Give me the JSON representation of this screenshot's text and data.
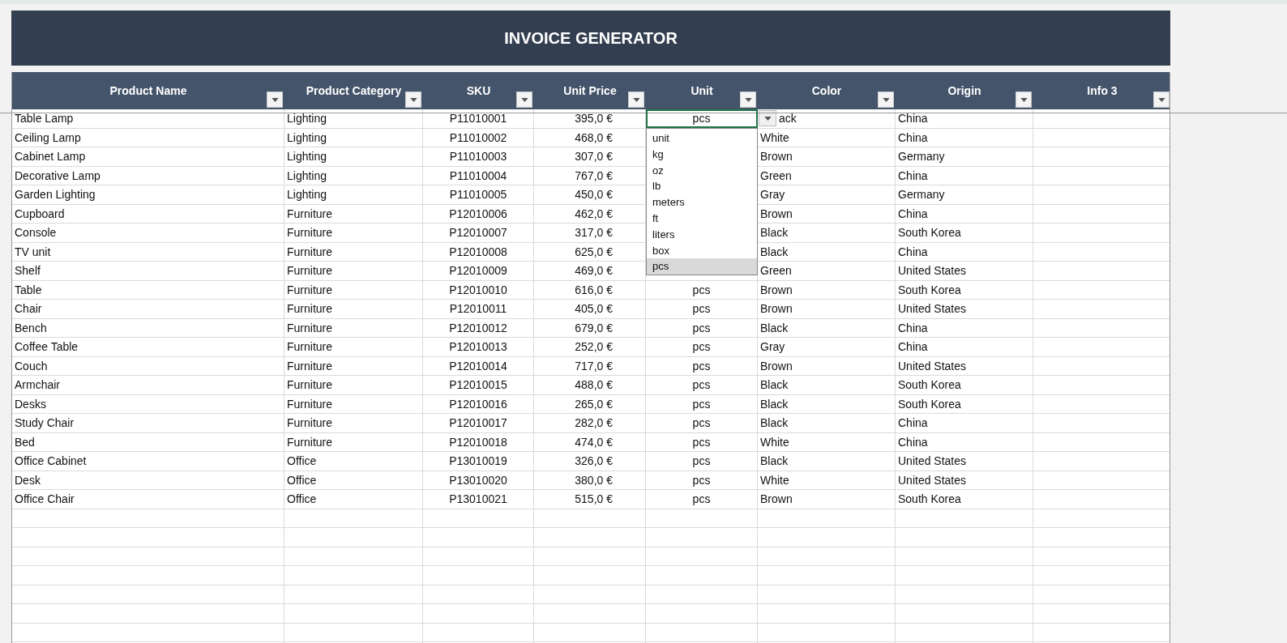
{
  "title": "INVOICE GENERATOR",
  "columns": [
    {
      "label": "Product Name"
    },
    {
      "label": "Product Category"
    },
    {
      "label": "SKU"
    },
    {
      "label": "Unit Price"
    },
    {
      "label": "Unit"
    },
    {
      "label": "Color"
    },
    {
      "label": "Origin"
    },
    {
      "label": "Info 3"
    }
  ],
  "rows": [
    {
      "cells": [
        "Table Lamp",
        "Lighting",
        "P11010001",
        "395,0 €",
        "pcs",
        "ack",
        "China"
      ],
      "active": true
    },
    {
      "cells": [
        "Ceiling Lamp",
        "Lighting",
        "P11010002",
        "468,0 €",
        "",
        "White",
        "China"
      ]
    },
    {
      "cells": [
        "Cabinet Lamp",
        "Lighting",
        "P11010003",
        "307,0 €",
        "",
        "Brown",
        "Germany"
      ]
    },
    {
      "cells": [
        "Decorative Lamp",
        "Lighting",
        "P11010004",
        "767,0 €",
        "",
        "Green",
        "China"
      ]
    },
    {
      "cells": [
        "Garden Lighting",
        "Lighting",
        "P11010005",
        "450,0 €",
        "",
        "Gray",
        "Germany"
      ]
    },
    {
      "cells": [
        "Cupboard",
        "Furniture",
        "P12010006",
        "462,0 €",
        "",
        "Brown",
        "China"
      ]
    },
    {
      "cells": [
        "Console",
        "Furniture",
        "P12010007",
        "317,0 €",
        "",
        "Black",
        "South Korea"
      ]
    },
    {
      "cells": [
        "TV unit",
        "Furniture",
        "P12010008",
        "625,0 €",
        "",
        "Black",
        "China"
      ]
    },
    {
      "cells": [
        "Shelf",
        "Furniture",
        "P12010009",
        "469,0 €",
        "",
        "Green",
        "United States"
      ]
    },
    {
      "cells": [
        "Table",
        "Furniture",
        "P12010010",
        "616,0 €",
        "pcs",
        "Brown",
        "South Korea"
      ]
    },
    {
      "cells": [
        "Chair",
        "Furniture",
        "P12010011",
        "405,0 €",
        "pcs",
        "Brown",
        "United States"
      ]
    },
    {
      "cells": [
        "Bench",
        "Furniture",
        "P12010012",
        "679,0 €",
        "pcs",
        "Black",
        "China"
      ]
    },
    {
      "cells": [
        "Coffee Table",
        "Furniture",
        "P12010013",
        "252,0 €",
        "pcs",
        "Gray",
        "China"
      ]
    },
    {
      "cells": [
        "Couch",
        "Furniture",
        "P12010014",
        "717,0 €",
        "pcs",
        "Brown",
        "United States"
      ]
    },
    {
      "cells": [
        "Armchair",
        "Furniture",
        "P12010015",
        "488,0 €",
        "pcs",
        "Black",
        "South Korea"
      ]
    },
    {
      "cells": [
        "Desks",
        "Furniture",
        "P12010016",
        "265,0 €",
        "pcs",
        "Black",
        "South Korea"
      ]
    },
    {
      "cells": [
        "Study Chair",
        "Furniture",
        "P12010017",
        "282,0 €",
        "pcs",
        "Black",
        "China"
      ]
    },
    {
      "cells": [
        "Bed",
        "Furniture",
        "P12010018",
        "474,0 €",
        "pcs",
        "White",
        "China"
      ]
    },
    {
      "cells": [
        "Office Cabinet",
        "Office",
        "P13010019",
        "326,0 €",
        "pcs",
        "Black",
        "United States"
      ]
    },
    {
      "cells": [
        "Desk",
        "Office",
        "P13010020",
        "380,0 €",
        "pcs",
        "White",
        "United States"
      ]
    },
    {
      "cells": [
        "Office Chair",
        "Office",
        "P13010021",
        "515,0 €",
        "pcs",
        "Brown",
        "South Korea"
      ]
    }
  ],
  "dropdown": {
    "options": [
      {
        "label": "unit",
        "selected": false
      },
      {
        "label": "kg",
        "selected": false
      },
      {
        "label": "oz",
        "selected": false
      },
      {
        "label": "lb",
        "selected": false
      },
      {
        "label": "meters",
        "selected": false
      },
      {
        "label": "ft",
        "selected": false
      },
      {
        "label": "liters",
        "selected": false
      },
      {
        "label": "box",
        "selected": false
      },
      {
        "label": "pcs",
        "selected": true
      }
    ]
  }
}
